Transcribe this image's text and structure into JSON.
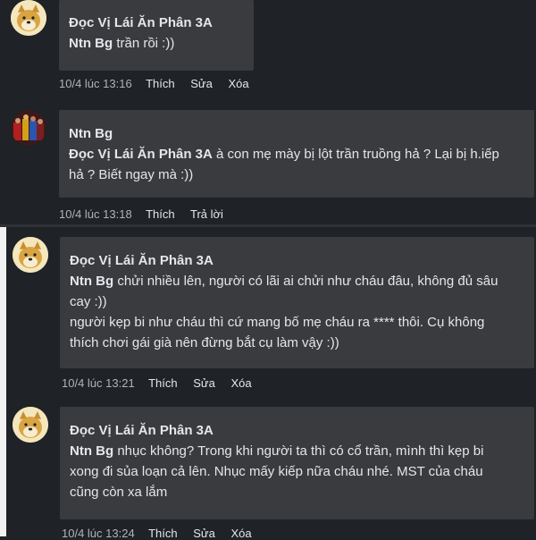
{
  "comments": [
    {
      "author": "Đọc Vị Lái Ăn Phân 3A",
      "mention": "Ntn Bg",
      "text": " trần rồi :))",
      "time": "10/4 lúc 13:16",
      "actions": [
        "Thích",
        "Sửa",
        "Xóa"
      ],
      "avatar_icon": "doge-avatar-icon"
    },
    {
      "author": "Ntn Bg",
      "mention": "Đọc Vị Lái Ăn Phân 3A",
      "text_line1": " à con mẹ mày bị lột trần truồng hả ? Lại bị h.iếp",
      "text_line2": "hả ? Biết ngay mà :))",
      "time": "10/4 lúc 13:18",
      "actions": [
        "Thích",
        "Trả lời"
      ],
      "avatar_icon": "superhero-avatar-icon"
    },
    {
      "author": "Đọc Vị Lái Ăn Phân 3A",
      "mention": "Ntn Bg",
      "text_line1": " chửi nhiều lên, người có lãi ai chửi như cháu đâu, không đủ sâu",
      "text_line2": "cay :))",
      "text_line3": "người kẹp bi như cháu thì cứ mang bố mẹ cháu ra **** thôi. Cụ không",
      "text_line4": "thích chơi gái già nên đừng bắt cụ làm vậy :))",
      "time": "10/4 lúc 13:21",
      "actions": [
        "Thích",
        "Sửa",
        "Xóa"
      ],
      "avatar_icon": "doge-avatar-icon"
    },
    {
      "author": "Đọc Vị Lái Ăn Phân 3A",
      "mention": "Ntn Bg",
      "text_line1": " nhục không? Trong khi người ta thì có cổ trần, mình thì kẹp bi",
      "text_line2": "xong đi sủa loạn cả lên. Nhục mấy kiếp nữa cháu nhé. MST của cháu",
      "text_line3": "cũng còn xa lắm",
      "time": "10/4 lúc 13:24",
      "actions": [
        "Thích",
        "Sửa",
        "Xóa"
      ],
      "avatar_icon": "doge-avatar-icon"
    }
  ],
  "colors": {
    "background": "#1f2226",
    "bubble": "#3a3b3e",
    "text": "#e4e6eb",
    "meta": "#b0b3b8"
  }
}
